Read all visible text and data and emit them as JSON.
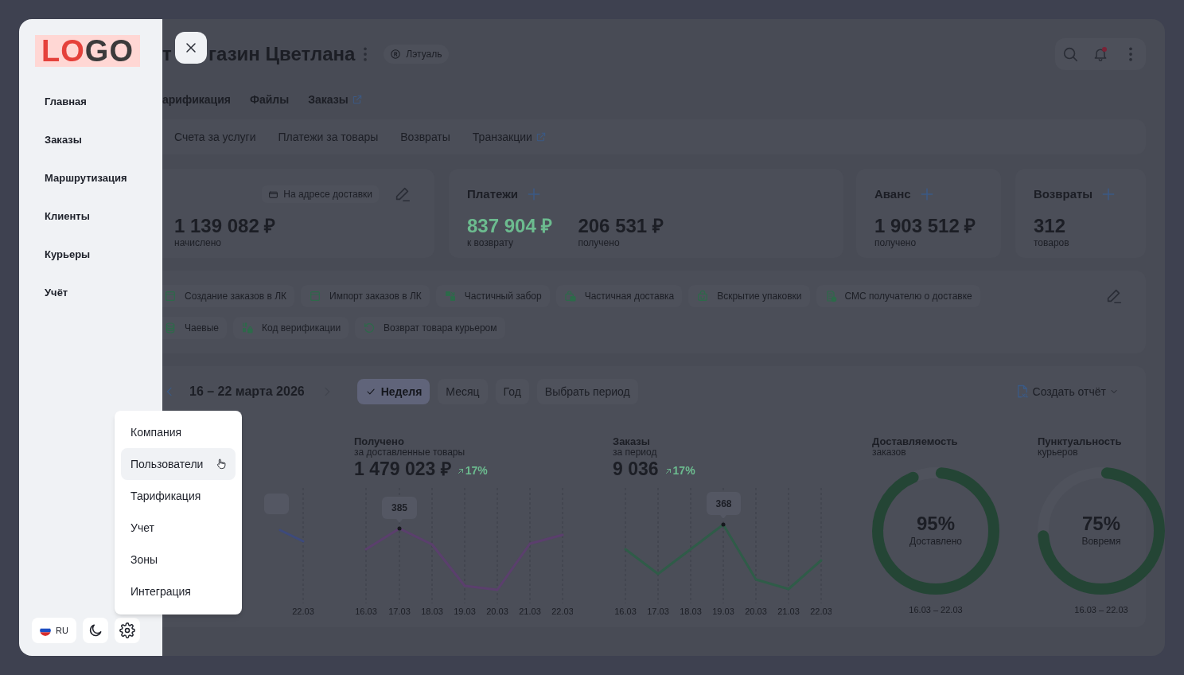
{
  "sidebar": {
    "logo": [
      {
        "text": "LO",
        "color": "#e5413b"
      },
      {
        "text": "GO",
        "color": "#3b3b3b"
      }
    ],
    "items": [
      "Главная",
      "Заказы",
      "Маршрутизация",
      "Клиенты",
      "Курьеры",
      "Учёт"
    ],
    "language": "RU"
  },
  "header": {
    "title_parts": [
      "т",
      "газин Цветлана"
    ],
    "badge": "Лэтуаль",
    "notification_dot": true
  },
  "tabs": [
    {
      "label": "арификация",
      "external": false
    },
    {
      "label": "Файлы",
      "external": false
    },
    {
      "label": "Заказы",
      "external": true
    }
  ],
  "subtabs": [
    {
      "label": "Счета за услуги",
      "external": false
    },
    {
      "label": "Платежи за товары",
      "external": false
    },
    {
      "label": "Возвраты",
      "external": false
    },
    {
      "label": "Транзакции",
      "external": true
    }
  ],
  "stat_cards": [
    {
      "badge": "На адресе доставки",
      "values": [
        {
          "value": "1 139 082 ₽",
          "caption": "начислено",
          "accent": false
        }
      ]
    },
    {
      "title": "Платежи",
      "values": [
        {
          "value": "837 904 ₽",
          "caption": "к возврату",
          "accent": true
        },
        {
          "value": "206 531 ₽",
          "caption": "получено",
          "accent": false
        }
      ]
    },
    {
      "title": "Аванс",
      "values": [
        {
          "value": "1 903 512 ₽",
          "caption": "получено",
          "accent": false
        }
      ]
    },
    {
      "title": "Возвраты",
      "values": [
        {
          "value": "312",
          "caption": "товаров",
          "accent": false
        }
      ]
    }
  ],
  "features": [
    [
      "Создание заказов в ЛК",
      "Импорт заказов в ЛК",
      "Частичный забор",
      "Частичная доставка",
      "Вскрытие упаковки",
      "СМС получателю о доставке"
    ],
    [
      "Чаевые",
      "Код верификации",
      "Возврат товара курьером"
    ]
  ],
  "analytics": {
    "period": "16 – 22 марта 2026",
    "periods": [
      {
        "label": "Неделя",
        "selected": true
      },
      {
        "label": "Месяц",
        "selected": false
      },
      {
        "label": "Год",
        "selected": false
      },
      {
        "label": "Выбрать период",
        "selected": false
      }
    ],
    "report": "Создать отчёт",
    "charts": [
      {
        "kind": "line_fragment",
        "color": "#3d4a7c",
        "x_labels": [
          "22.03"
        ]
      },
      {
        "kind": "line",
        "title": "Получено",
        "subtitle": "за доставленные товары",
        "value": "1 479 023 ₽",
        "change": "17%",
        "tooltip": "385",
        "color": "#5b3f6d",
        "x_labels": [
          "16.03",
          "17.03",
          "18.03",
          "19.03",
          "20.03",
          "21.03",
          "22.03"
        ]
      },
      {
        "kind": "line",
        "title": "Заказы",
        "subtitle": "за период",
        "value": "9 036",
        "change": "17%",
        "tooltip": "368",
        "color": "#2f5c48",
        "x_labels": [
          "16.03",
          "17.03",
          "18.03",
          "19.03",
          "20.03",
          "21.03",
          "22.03"
        ]
      },
      {
        "kind": "donut",
        "title": "Доставляемость",
        "subtitle": "заказов",
        "reading": "95%",
        "caption": "Доставлено",
        "level": 0.95,
        "range": "16.03 – 22.03"
      },
      {
        "kind": "donut",
        "title": "Пунктуальность",
        "subtitle": "курьеров",
        "reading": "75%",
        "caption": "Вовремя",
        "level": 0.75,
        "range": "16.03 – 22.03"
      }
    ]
  },
  "menu": [
    {
      "label": "Компания",
      "selected": false
    },
    {
      "label": "Пользователи",
      "selected": true
    },
    {
      "label": "Тарификация",
      "selected": false
    },
    {
      "label": "Учет",
      "selected": false
    },
    {
      "label": "Зоны",
      "selected": false
    },
    {
      "label": "Интеграция",
      "selected": false
    }
  ]
}
